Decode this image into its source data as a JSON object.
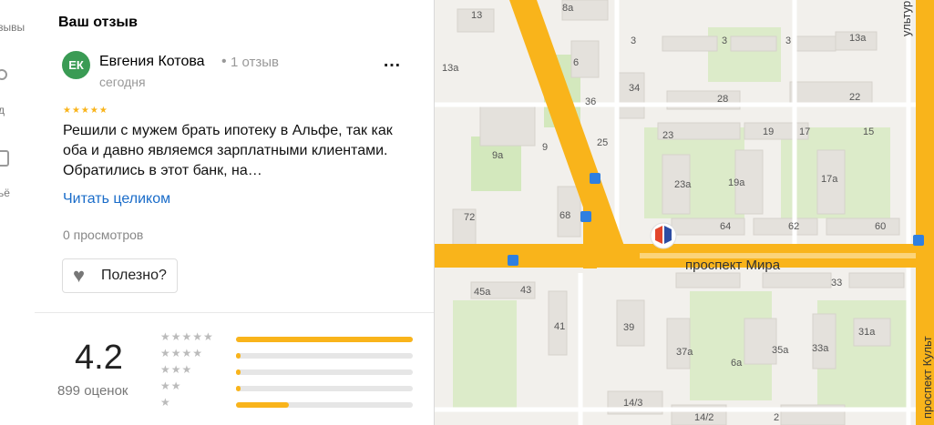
{
  "rail": {
    "items": [
      {
        "label": "зывы"
      },
      {
        "label": "д"
      },
      {
        "label": "ьё"
      }
    ]
  },
  "review_panel": {
    "title": "Ваш отзыв",
    "author": {
      "initials": "ЕК",
      "name": "Евгения Котова",
      "separator": "•",
      "review_count": "1 отзыв",
      "date": "сегодня"
    },
    "rating_stars": 5,
    "text": "Решили с мужем брать ипотеку в Альфе, так как оба и давно являемся зарплатными клиентами. Обратились в этот банк, на…",
    "read_more": "Читать целиком",
    "views": "0 просмотров",
    "useful_label": "Полезно?"
  },
  "rating_summary": {
    "score": "4.2",
    "count_label": "899 оценок",
    "distribution": [
      {
        "stars": 5,
        "fraction": 1.0
      },
      {
        "stars": 4,
        "fraction": 0.02
      },
      {
        "stars": 3,
        "fraction": 0.02
      },
      {
        "stars": 2,
        "fraction": 0.02
      },
      {
        "stars": 1,
        "fraction": 0.3
      }
    ]
  },
  "map": {
    "street_mira": "проспект Мира",
    "street_kultury_top": "ультуры",
    "street_kultury_side": "проспект Культ",
    "house_numbers": [
      "13",
      "8а",
      "3",
      "3",
      "3",
      "13а",
      "6",
      "13а",
      "36",
      "34",
      "28",
      "22",
      "25",
      "23",
      "19",
      "17",
      "9",
      "9а",
      "15",
      "19а",
      "17а",
      "23а",
      "72",
      "68",
      "64",
      "62",
      "60",
      "45а",
      "43",
      "33",
      "41",
      "39",
      "35а",
      "33а",
      "31а",
      "37а",
      "6а",
      "14/3",
      "14/2",
      "2"
    ]
  },
  "colors": {
    "accent_link": "#1a6cc9",
    "star": "#f9b41b",
    "avatar": "#3a9b54",
    "road": "#f9b41b",
    "marker": "#e3462c"
  }
}
